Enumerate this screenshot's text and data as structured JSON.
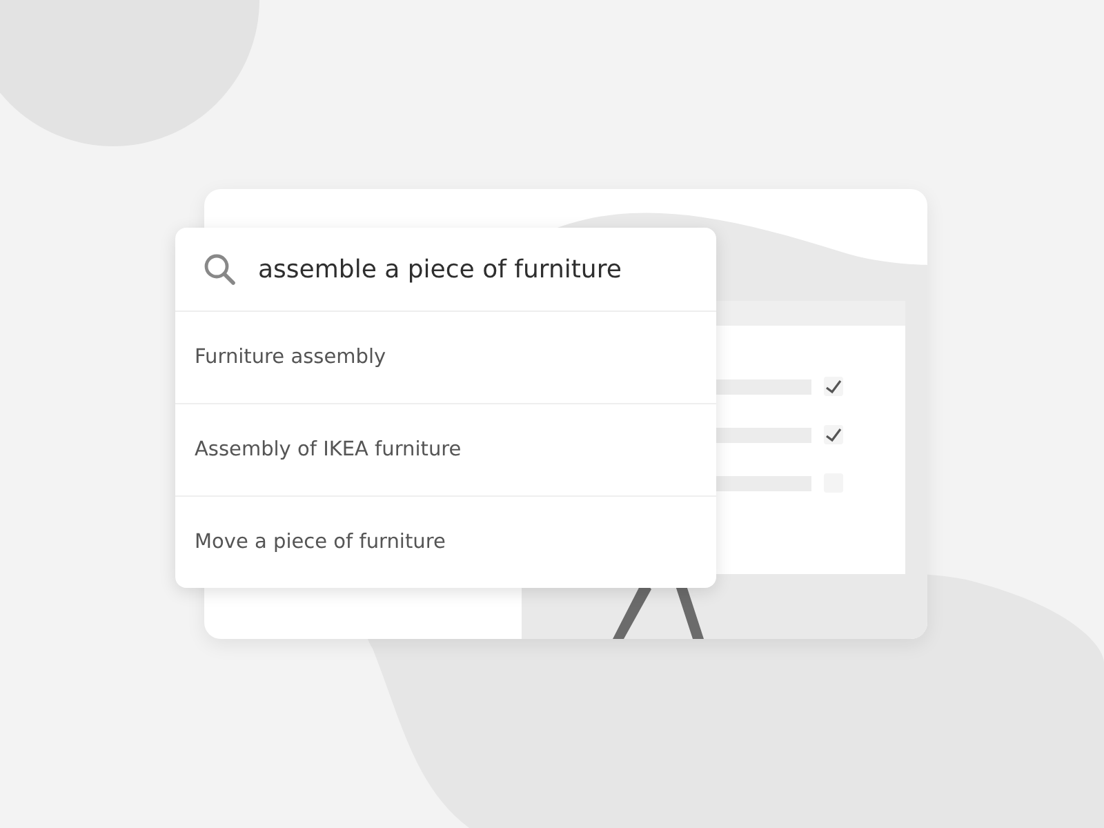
{
  "search": {
    "value": "assemble a piece of furniture"
  },
  "suggestions": [
    {
      "label": "Furniture assembly"
    },
    {
      "label": "Assembly of IKEA furniture"
    },
    {
      "label": "Move a piece of furniture"
    }
  ],
  "checklist": [
    {
      "checked": true
    },
    {
      "checked": true
    },
    {
      "checked": false
    }
  ]
}
